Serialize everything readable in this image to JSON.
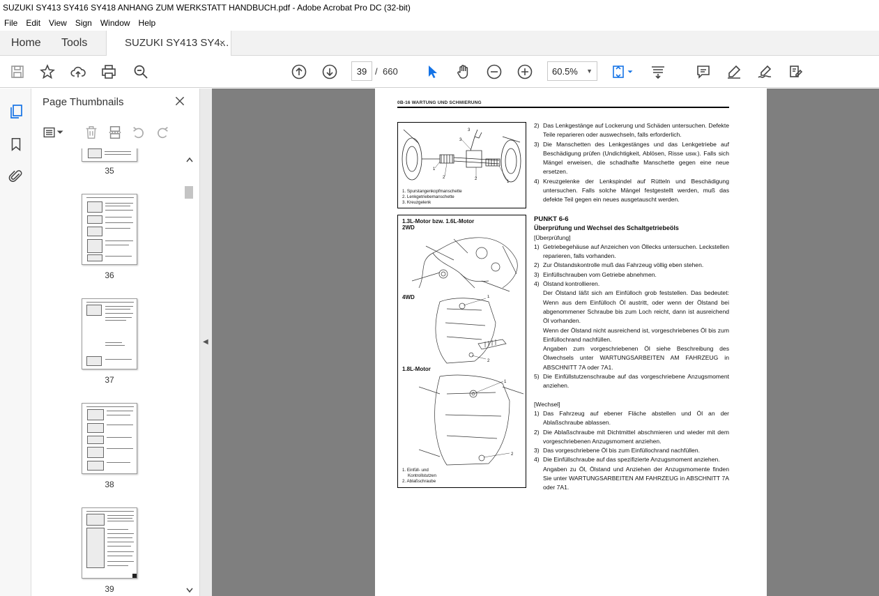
{
  "window": {
    "title": "SUZUKI SY413 SY416 SY418 ANHANG ZUM WERKSTATT HANDBUCH.pdf - Adobe Acrobat Pro DC (32-bit)"
  },
  "menu": [
    "File",
    "Edit",
    "View",
    "Sign",
    "Window",
    "Help"
  ],
  "tabs": {
    "home": "Home",
    "tools": "Tools",
    "document": "SUZUKI SY413 SY4...",
    "close": "×"
  },
  "nav": {
    "current_page": "39",
    "separator": "/",
    "total_pages": "660",
    "zoom": "60.5%"
  },
  "sidebar": {
    "title": "Page Thumbnails",
    "thumbnails": [
      "35",
      "36",
      "37",
      "38",
      "39"
    ]
  },
  "page": {
    "header": "0B-16   WARTUNG UND SCHMIERUNG",
    "fig1": {
      "captions": [
        "1. Spurstangenkopfmanschette",
        "2. Lenkgetriebemanschette",
        "3. Kreuzgelenk"
      ]
    },
    "fig2": {
      "label_top": "1.3L-Motor bzw. 1.6L-Motor",
      "label_2wd": "2WD",
      "label_4wd": "4WD",
      "label_18": "1.8L-Motor",
      "captions": [
        "1. Einfüll- und",
        "Kontrollstutzen",
        "2. Ablaßschraube"
      ]
    },
    "col1": [
      {
        "n": "2)",
        "t": "Das Lenkgestänge auf Lockerung und Schäden untersuchen. Defekte Teile reparieren oder auswechseln, falls erforderlich."
      },
      {
        "n": "3)",
        "t": "Die Manschetten des Lenkgestänges und das Lenkgetriebe auf Beschädigung prüfen (Undichtigkeit, Ablösen, Risse usw.). Falls sich Mängel erweisen, die schadhafte Manschette gegen eine neue ersetzen."
      },
      {
        "n": "4)",
        "t": "Kreuzgelenke der Lenkspindel auf Rütteln und Beschädigung untersuchen. Falls solche Mängel festgestellt werden, muß das defekte Teil gegen ein neues ausgetauscht werden."
      }
    ],
    "section": {
      "title": "PUNKT 6-6",
      "subtitle": "Überprüfung und Wechsel des Schaltgetriebeöls",
      "check_label": "[Überprüfung]",
      "check": [
        {
          "n": "1)",
          "t": "Getriebegehäuse auf Anzeichen von Öllecks untersuchen. Leckstellen reparieren, falls vorhanden."
        },
        {
          "n": "2)",
          "t": "Zur Ölstandskontrolle muß das Fahrzeug völlig eben stehen."
        },
        {
          "n": "3)",
          "t": "Einfüllschrauben vom Getriebe abnehmen."
        },
        {
          "n": "4)",
          "t": "Ölstand kontrollieren."
        }
      ],
      "check_para1": "Der Ölstand läßt sich am Einfülloch grob feststellen. Das bedeutet: Wenn aus dem Einfülloch Öl austritt, oder wenn der Ölstand bei abgenommener Schraube bis zum Loch reicht, dann ist ausreichend Öl vorhanden.",
      "check_para2": "Wenn der Ölstand nicht ausreichend ist, vorgeschriebenes Öl bis zum Einfüllochrand nachfüllen.",
      "check_para3": "Angaben zum vorgeschriebenen Öl siehe Beschreibung des Ölwechsels unter WARTUNGSARBEITEN AM FAHRZEUG in ABSCHNITT 7A oder 7A1.",
      "check5": {
        "n": "5)",
        "t": "Die Einfüllstutzenschraube auf das vorgeschriebene Anzugsmoment anziehen."
      },
      "change_label": "[Wechsel]",
      "change": [
        {
          "n": "1)",
          "t": "Das Fahrzeug auf ebener Fläche abstellen und Öl an der Ablaßschraube ablassen."
        },
        {
          "n": "2)",
          "t": "Die Ablaßschraube mit Dichtmittel abschmieren und wieder mit dem vorgeschriebenen Anzugsmoment anziehen."
        },
        {
          "n": "3)",
          "t": "Das vorgeschriebene Öl bis zum Einfüllochrand nachfüllen."
        },
        {
          "n": "4)",
          "t": "Die Einfüllschraube auf das spezifizierte Anzugsmoment anziehen."
        }
      ],
      "change_para": "Angaben zu Öl, Ölstand und Anziehen der Anzugsmomente finden Sie unter WARTUNGSARBEITEN AM FAHRZEUG in ABSCHNITT 7A oder 7A1."
    }
  }
}
